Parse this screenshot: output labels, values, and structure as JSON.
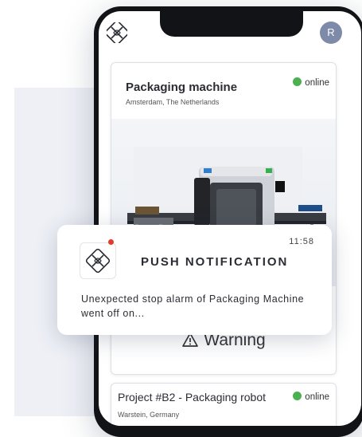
{
  "avatar": {
    "initial": "R"
  },
  "devices": [
    {
      "title": "Packaging machine",
      "location": "Amsterdam, The Netherlands",
      "status": "online",
      "alert": "Warning"
    },
    {
      "title": "Project #B2 - Packaging robot",
      "location": "Warstein, Germany",
      "status": "online"
    }
  ],
  "notification": {
    "time": "11:58",
    "title": "PUSH NOTIFICATION",
    "body": "Unexpected stop alarm of Packaging Machine went off on..."
  },
  "colors": {
    "online": "#4cb050",
    "unread_dot": "#e03b2c",
    "avatar": "#7d8ba8"
  },
  "icons": [
    "app-logo-icon",
    "warning-icon",
    "status-dot-icon",
    "machine-illustration"
  ]
}
